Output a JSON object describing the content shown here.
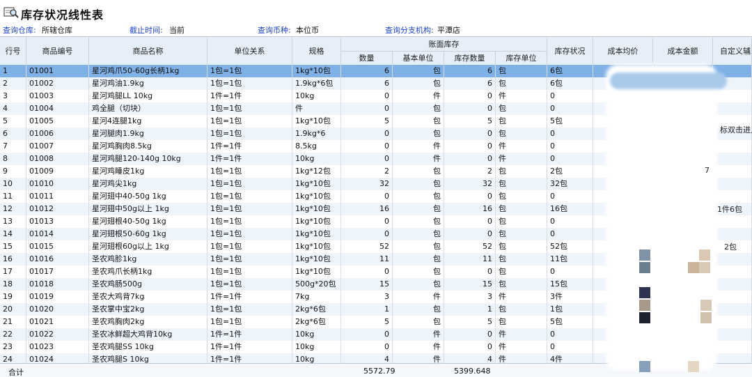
{
  "window": {
    "title": "库存状况线性表",
    "icon": "search-report-icon"
  },
  "filters": [
    {
      "label": "查询仓库:",
      "value": "所辖仓库"
    },
    {
      "label": "截止时间:",
      "value": "当前"
    },
    {
      "label": "查询币种:",
      "value": "本位币"
    },
    {
      "label": "查询分支机构:",
      "value": "平潭店"
    }
  ],
  "columns": {
    "row_no": "行号",
    "code": "商品编号",
    "name": "商品名称",
    "unit_relation": "单位关系",
    "spec": "规格",
    "book_stock_group": "账面库存",
    "qty": "数量",
    "base_unit": "基本单位",
    "stock_qty": "库存数量",
    "stock_unit": "库存单位",
    "stock_status": "库存状况",
    "cost_avg": "成本均价",
    "cost_amount": "成本金额",
    "custom": "自定义辅助"
  },
  "rows": [
    [
      "1",
      "01001",
      "星河鸡爪50-60g长柄1kg",
      "1包=1包",
      "1kg*10包",
      "6",
      "包",
      "6",
      "包",
      "6包"
    ],
    [
      "2",
      "01002",
      "星河鸡油1.9kg",
      "1包=1包",
      "1.9kg*6包",
      "6",
      "包",
      "6",
      "包",
      "6包"
    ],
    [
      "3",
      "01003",
      "星河鸡腿LL 10kg",
      "1件=1件",
      "10kg",
      "0",
      "件",
      "0",
      "件",
      "0"
    ],
    [
      "4",
      "01004",
      "鸡全腿（切块）",
      "1包=1包",
      "件",
      "0",
      "包",
      "0",
      "包",
      "0"
    ],
    [
      "5",
      "01005",
      "星河4连腿1kg",
      "1包=1包",
      "1kg*10包",
      "5",
      "包",
      "5",
      "包",
      "5包"
    ],
    [
      "6",
      "01006",
      "星河腿肉1.9kg",
      "1包=1包",
      "1.9kg*6",
      "0",
      "包",
      "0",
      "包",
      "0"
    ],
    [
      "7",
      "01007",
      "星河鸡胸肉8.5kg",
      "1件=1件",
      "8.5kg",
      "0",
      "件",
      "0",
      "件",
      "0"
    ],
    [
      "8",
      "01008",
      "星河鸡腿120-140g 10kg",
      "1件=1件",
      "10kg",
      "0",
      "件",
      "0",
      "件",
      "0"
    ],
    [
      "9",
      "01009",
      "星河鸡睡皮1kg",
      "1包=1包",
      "1kg*12包",
      "2",
      "包",
      "2",
      "包",
      "2包"
    ],
    [
      "10",
      "01010",
      "星河鸡尖1kg",
      "1包=1包",
      "1kg*10包",
      "32",
      "包",
      "32",
      "包",
      "32包"
    ],
    [
      "11",
      "01011",
      "星河翅中40-50g 1kg",
      "1包=1包",
      "1kg*10包",
      "0",
      "包",
      "0",
      "包",
      "0"
    ],
    [
      "12",
      "01012",
      "星河翅中50g以上 1kg",
      "1包=1包",
      "1kg*10包",
      "16",
      "包",
      "16",
      "包",
      "16包"
    ],
    [
      "13",
      "01013",
      "星河翅根40-50g 1kg",
      "1包=1包",
      "1kg*10包",
      "0",
      "包",
      "0",
      "包",
      "0"
    ],
    [
      "14",
      "01014",
      "星河翅根50-60g 1kg",
      "1包=1包",
      "1kg*10包",
      "0",
      "包",
      "0",
      "包",
      "0"
    ],
    [
      "15",
      "01015",
      "星河翅根60g以上 1kg",
      "1包=1包",
      "1kg*10包",
      "52",
      "包",
      "52",
      "包",
      "52包"
    ],
    [
      "16",
      "01016",
      "圣农鸡胗1kg",
      "1包=1包",
      "1kg*10包",
      "11",
      "包",
      "11",
      "包",
      "11包"
    ],
    [
      "17",
      "01017",
      "圣农鸡爪长柄1kg",
      "1包=1包",
      "1kg*10包",
      "0",
      "包",
      "0",
      "包",
      "0"
    ],
    [
      "18",
      "01018",
      "圣农鸡肠500g",
      "1包=1包",
      "500g*20包",
      "15",
      "包",
      "15",
      "包",
      "15包"
    ],
    [
      "19",
      "01019",
      "圣农大鸡背7kg",
      "1件=1件",
      "7kg",
      "3",
      "件",
      "3",
      "件",
      "3件"
    ],
    [
      "20",
      "01020",
      "圣农掌中宝2kg",
      "1包=1包",
      "2kg*6包",
      "1",
      "包",
      "1",
      "包",
      "1包"
    ],
    [
      "21",
      "01021",
      "圣农鸡胸肉2kg",
      "1包=1包",
      "2kg*6包",
      "5",
      "包",
      "5",
      "包",
      "5包"
    ],
    [
      "22",
      "01022",
      "圣农冰鲜超大鸡背10kg",
      "1件=1件",
      "10kg",
      "0",
      "件",
      "0",
      "件",
      "0"
    ],
    [
      "23",
      "01023",
      "圣农鸡腿SS 10kg",
      "1件=1件",
      "10kg",
      "0",
      "件",
      "0",
      "件",
      "0"
    ],
    [
      "24",
      "01024",
      "圣农鸡腿S 10kg",
      "1件=1件",
      "10kg",
      "4",
      "件",
      "4",
      "件",
      "4件"
    ]
  ],
  "side_fragments": [
    "标双击进入",
    "7",
    "1件6包",
    "2包"
  ],
  "footer": {
    "label": "合计",
    "qty_total": "5572.79",
    "stock_total": "5399.648"
  },
  "colors": {
    "selected_row": "#7fb1e6",
    "header_bg": "#e6eef8",
    "label_blue": "#1f44c8"
  }
}
